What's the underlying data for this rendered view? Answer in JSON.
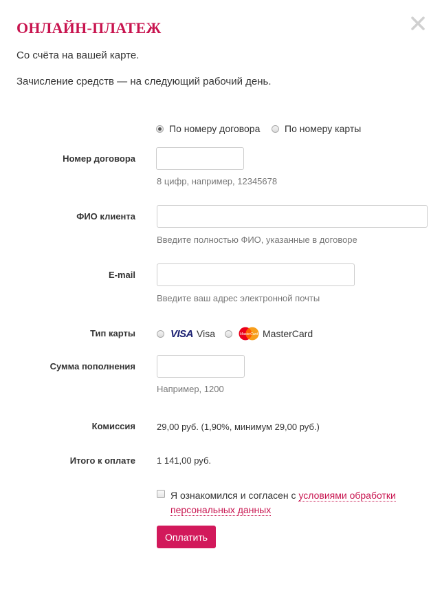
{
  "dialog": {
    "title": "ОНЛАЙН-ПЛАТЕЖ",
    "intro_line1": "Со счёта на вашей карте.",
    "intro_line2": "Зачисление средств — на следующий рабочий день."
  },
  "mode": {
    "option_contract": "По номеру договора",
    "option_card": "По номеру карты",
    "selected": "По номеру договора"
  },
  "fields": {
    "contract": {
      "label": "Номер договора",
      "value": "",
      "hint": "8 цифр, например, 12345678"
    },
    "fio": {
      "label": "ФИО клиента",
      "value": "",
      "hint": "Введите полностью ФИО, указанные в договоре"
    },
    "email": {
      "label": "E-mail",
      "value": "",
      "hint": "Введите ваш адрес электронной почты"
    },
    "card_type": {
      "label": "Тип карты",
      "visa_logo": "VISA",
      "visa": "Visa",
      "mastercard_logo": "MasterCard",
      "mastercard": "MasterCard"
    },
    "amount": {
      "label": "Сумма пополнения",
      "value": "",
      "hint": "Например, 1200"
    }
  },
  "summary": {
    "commission_label": "Комиссия",
    "commission_value": "29,00 руб. (1,90%, минимум 29,00 руб.)",
    "total_label": "Итого к оплате",
    "total_value": "1 141,00 руб."
  },
  "consent": {
    "text": "Я ознакомился и согласен с",
    "link_text": "условиями обработки персональных данных",
    "checked": false
  },
  "submit": {
    "label": "Оплатить"
  },
  "icons": {
    "close": "close-icon",
    "visa": "visa-logo",
    "mastercard": "mastercard-logo"
  },
  "colors": {
    "accent": "#c8144f",
    "button": "#d2195b",
    "hint": "#777777",
    "border": "#cccccc"
  }
}
